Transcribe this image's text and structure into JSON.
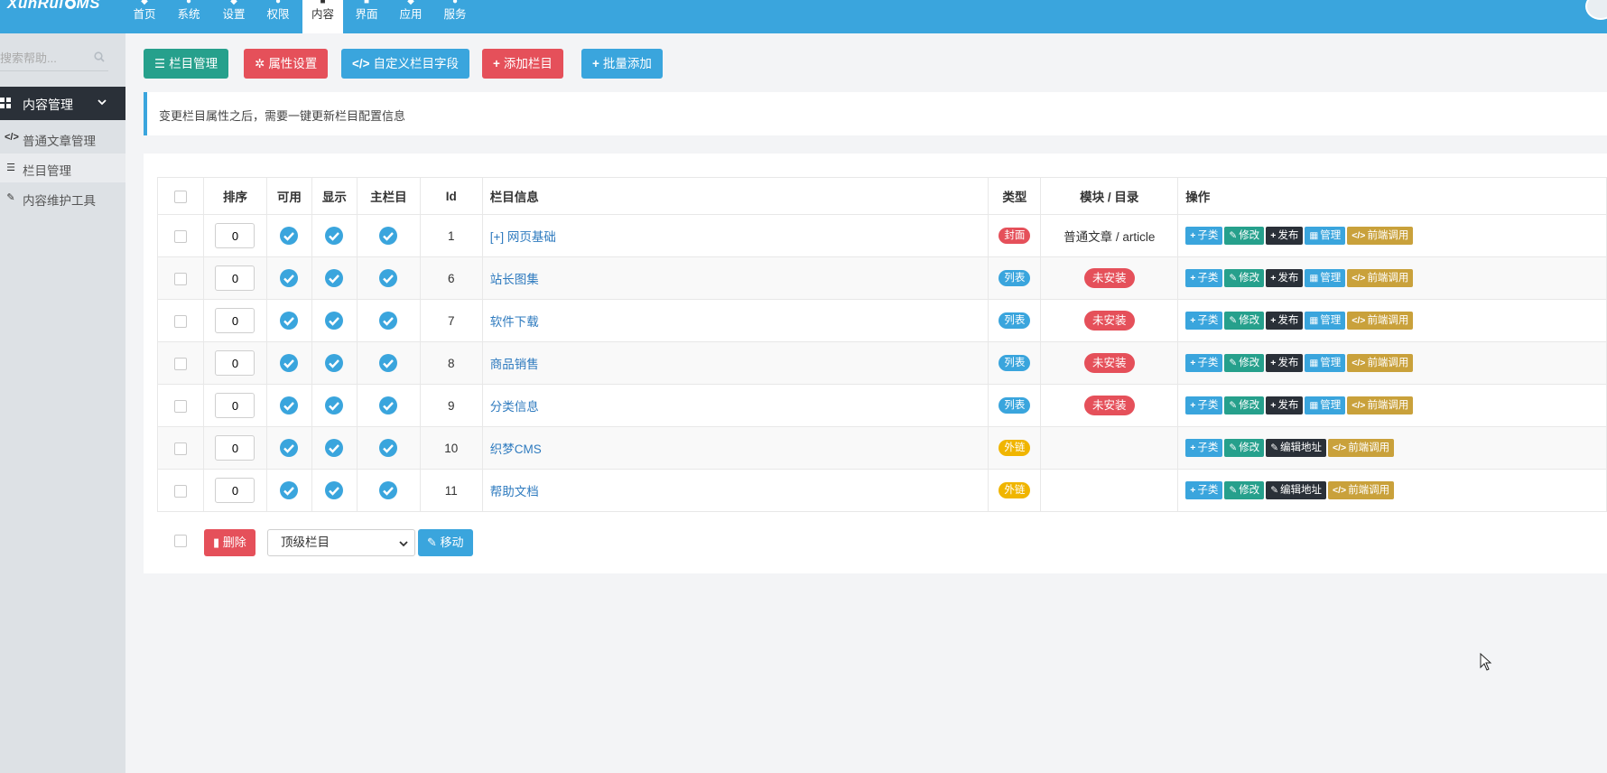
{
  "brand": {
    "logo_left": "XunRui",
    "logo_right": "MS"
  },
  "nav": [
    {
      "label": "首页",
      "icon": "home-icon"
    },
    {
      "label": "系统",
      "icon": "gear-icon"
    },
    {
      "label": "设置",
      "icon": "wrench-icon"
    },
    {
      "label": "权限",
      "icon": "user-icon"
    },
    {
      "label": "内容",
      "icon": "grid-icon"
    },
    {
      "label": "界面",
      "icon": "monitor-icon"
    },
    {
      "label": "应用",
      "icon": "cube-icon"
    },
    {
      "label": "服务",
      "icon": "cloud-icon"
    }
  ],
  "nav_active": "内容",
  "sidebar": {
    "search_placeholder": "搜索帮助...",
    "group_label": "内容管理",
    "items": [
      {
        "label": "普通文章管理",
        "icon": "code-icon"
      },
      {
        "label": "栏目管理",
        "icon": "list-icon"
      },
      {
        "label": "内容维护工具",
        "icon": "wrench-icon"
      }
    ]
  },
  "toolbar": {
    "manage": "栏目管理",
    "props": "属性设置",
    "fields": "自定义栏目字段",
    "add": "添加栏目",
    "batch_add": "批量添加"
  },
  "notice": "变更栏目属性之后，需要一键更新栏目配置信息",
  "table": {
    "headers": {
      "order": "排序",
      "enabled": "可用",
      "show": "显示",
      "main": "主栏目",
      "id": "Id",
      "info": "栏目信息",
      "type": "类型",
      "module": "模块 / 目录",
      "ops": "操作"
    },
    "rows": [
      {
        "order": "0",
        "id": "1",
        "name": "[+] 网页基础",
        "type": "封面",
        "module": "普通文章 / article",
        "ops": [
          "子类",
          "修改",
          "发布",
          "管理",
          "前端调用"
        ]
      },
      {
        "order": "0",
        "id": "6",
        "name": "站长图集",
        "type": "列表",
        "module": "未安装",
        "ops": [
          "子类",
          "修改",
          "发布",
          "管理",
          "前端调用"
        ]
      },
      {
        "order": "0",
        "id": "7",
        "name": "软件下载",
        "type": "列表",
        "module": "未安装",
        "ops": [
          "子类",
          "修改",
          "发布",
          "管理",
          "前端调用"
        ]
      },
      {
        "order": "0",
        "id": "8",
        "name": "商品销售",
        "type": "列表",
        "module": "未安装",
        "ops": [
          "子类",
          "修改",
          "发布",
          "管理",
          "前端调用"
        ]
      },
      {
        "order": "0",
        "id": "9",
        "name": "分类信息",
        "type": "列表",
        "module": "未安装",
        "ops": [
          "子类",
          "修改",
          "发布",
          "管理",
          "前端调用"
        ]
      },
      {
        "order": "0",
        "id": "10",
        "name": "织梦CMS",
        "type": "外链",
        "module": "",
        "ops": [
          "子类",
          "修改",
          "编辑地址",
          "前端调用"
        ]
      },
      {
        "order": "0",
        "id": "11",
        "name": "帮助文档",
        "type": "外链",
        "module": "",
        "ops": [
          "子类",
          "修改",
          "编辑地址",
          "前端调用"
        ]
      }
    ]
  },
  "footer": {
    "delete": "删除",
    "select_value": "顶级栏目",
    "move": "移动"
  },
  "colors": {
    "primary": "#3aa5dd",
    "green": "#26a08c",
    "red": "#e5505a",
    "dark": "#2a3038",
    "gold": "#c9a13b",
    "yellow": "#f0b500"
  }
}
